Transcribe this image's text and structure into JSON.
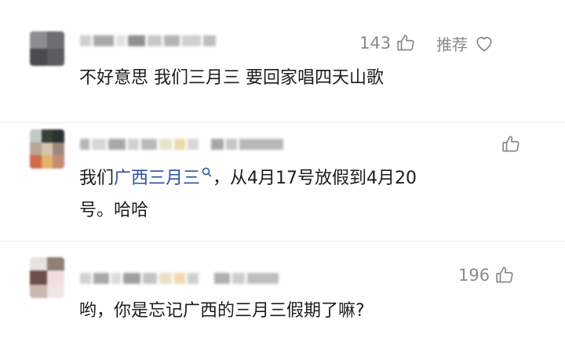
{
  "comments": [
    {
      "text": "不好意思 我们三月三 要回家唱四天山歌",
      "like_count": "143",
      "recommend_label": "推荐"
    },
    {
      "text_before": "我们",
      "link_text": "广西三月三",
      "text_after_line1": "，从4月17号放假到4月20",
      "text_line2": "号。哈哈"
    },
    {
      "text": "哟，你是忘记广西的三月三假期了嘛?",
      "like_count": "196"
    }
  ],
  "icons": {
    "like": "thumbs-up-icon",
    "recommend": "heart-icon",
    "search": "search-icon"
  },
  "colors": {
    "link": "#2b4fa3",
    "meta": "#8a8a8a",
    "text": "#1c1c1c"
  }
}
